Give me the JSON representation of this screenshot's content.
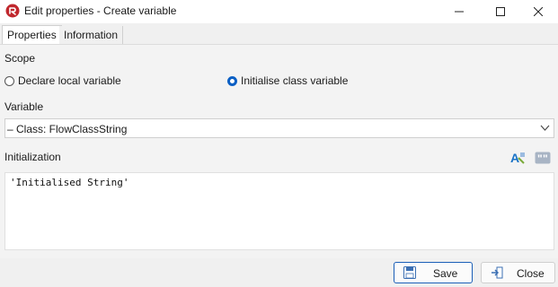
{
  "window": {
    "title": "Edit properties - Create variable",
    "controls": [
      "minimize-icon",
      "maximize-icon",
      "close-icon"
    ]
  },
  "tabs": [
    {
      "label": "Properties",
      "active": true
    },
    {
      "label": "Information",
      "active": false
    }
  ],
  "scope": {
    "label": "Scope",
    "options": [
      {
        "label": "Declare local variable",
        "checked": false
      },
      {
        "label": "Initialise class variable",
        "checked": true
      }
    ]
  },
  "variable": {
    "label": "Variable",
    "selected": "– Class: FlowClassString"
  },
  "initialization": {
    "label": "Initialization",
    "value": "'Initialised String'",
    "tools": [
      "text-style-icon",
      "quote-icon"
    ]
  },
  "footer": {
    "save_label": "Save",
    "close_label": "Close"
  },
  "colors": {
    "accent": "#0a5fc4",
    "app_icon": "#c0272d"
  }
}
